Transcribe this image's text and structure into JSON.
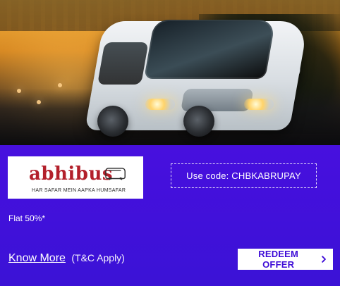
{
  "hero": {
    "image_icon": "bus-photo"
  },
  "brand": {
    "name": "abhibus",
    "tagline": "HAR SAFAR MEIN AAPKA HUMSAFAR",
    "logo_icon": "abhibus-logo"
  },
  "coupon": {
    "text": "Use code: CHBKABRUPAY"
  },
  "offer": {
    "text": "Flat 50%*"
  },
  "footer": {
    "know_more": "Know More",
    "tc": "(T&C Apply)"
  },
  "cta": {
    "label": "REDEEM OFFER",
    "icon": "chevron-right-icon"
  },
  "colors": {
    "background": "#3b12cf",
    "accent": "#3d0bd7",
    "logo_red": "#b3202b"
  }
}
